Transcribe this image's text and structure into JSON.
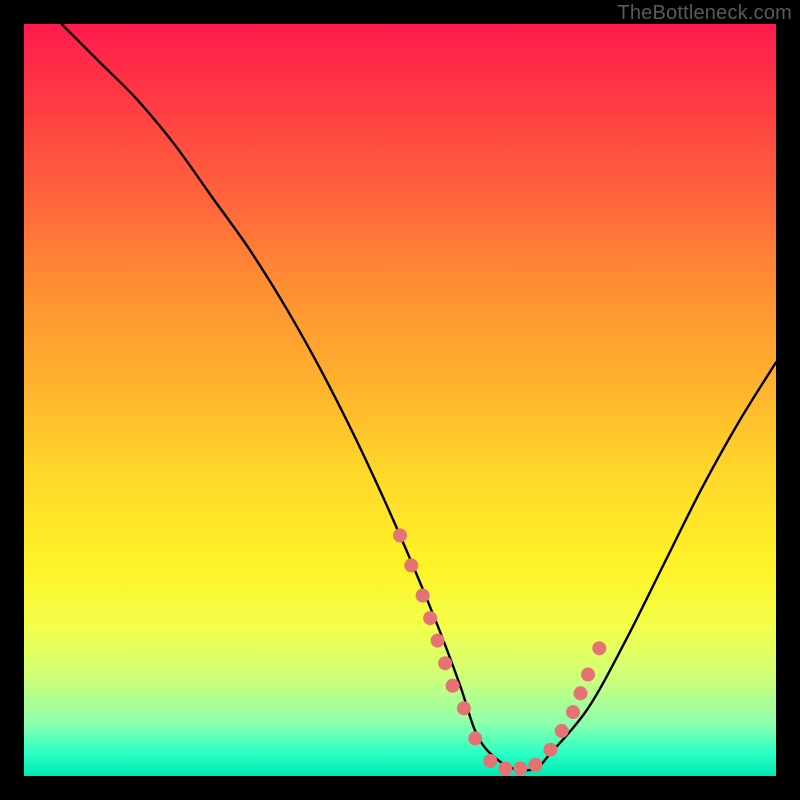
{
  "watermark": "TheBottleneck.com",
  "chart_data": {
    "type": "line",
    "title": "",
    "xlabel": "",
    "ylabel": "",
    "xlim": [
      0,
      100
    ],
    "ylim": [
      0,
      100
    ],
    "series": [
      {
        "name": "bottleneck-curve",
        "x": [
          5,
          10,
          15,
          20,
          25,
          30,
          35,
          40,
          45,
          50,
          55,
          58,
          60,
          62,
          65,
          68,
          70,
          75,
          80,
          85,
          90,
          95,
          100
        ],
        "values": [
          100,
          95,
          90,
          84,
          77,
          70,
          62,
          53,
          43,
          32,
          20,
          12,
          6,
          3,
          1,
          1,
          3,
          9,
          18,
          28,
          38,
          47,
          55
        ]
      }
    ],
    "markers": {
      "name": "highlight-dots",
      "color": "#e57373",
      "x": [
        50,
        51.5,
        53,
        54,
        55,
        56,
        57,
        58.5,
        60,
        62,
        64,
        66,
        68,
        70,
        71.5,
        73,
        74,
        75,
        76.5
      ],
      "values": [
        32,
        28,
        24,
        21,
        18,
        15,
        12,
        9,
        5,
        2,
        1,
        1,
        1.5,
        3.5,
        6,
        8.5,
        11,
        13.5,
        17
      ]
    },
    "background_gradient": {
      "top": "#ff1a4d",
      "mid": "#ffd82a",
      "bottom": "#00e8b3"
    }
  }
}
